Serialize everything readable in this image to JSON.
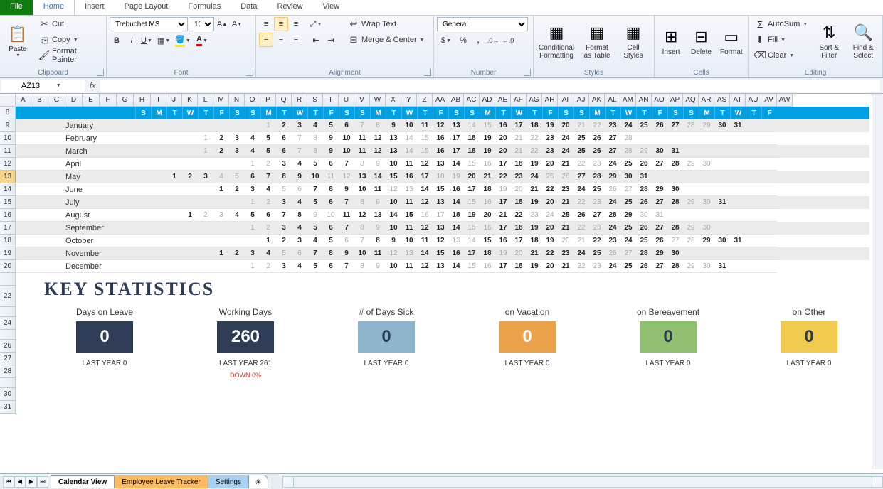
{
  "tabs": {
    "file": "File",
    "home": "Home",
    "insert": "Insert",
    "page_layout": "Page Layout",
    "formulas": "Formulas",
    "data": "Data",
    "review": "Review",
    "view": "View"
  },
  "ribbon": {
    "clipboard": {
      "paste": "Paste",
      "cut": "Cut",
      "copy": "Copy",
      "format_painter": "Format Painter",
      "label": "Clipboard"
    },
    "font": {
      "name": "Trebuchet MS",
      "size": "10",
      "label": "Font"
    },
    "alignment": {
      "wrap": "Wrap Text",
      "merge": "Merge & Center",
      "label": "Alignment"
    },
    "number": {
      "format": "General",
      "label": "Number"
    },
    "styles": {
      "cond": "Conditional\nFormatting",
      "table": "Format\nas Table",
      "cell": "Cell\nStyles",
      "label": "Styles"
    },
    "cells": {
      "insert": "Insert",
      "delete": "Delete",
      "format": "Format",
      "label": "Cells"
    },
    "editing": {
      "autosum": "AutoSum",
      "fill": "Fill",
      "clear": "Clear",
      "sort": "Sort &\nFilter",
      "find": "Find &\nSelect",
      "label": "Editing"
    }
  },
  "namebox": "AZ13",
  "col_widths": {
    "A": 22,
    "month": 168,
    "day": 22
  },
  "columns": [
    "A",
    "B",
    "C",
    "D",
    "E",
    "F",
    "G",
    "H",
    "I",
    "J",
    "K",
    "L",
    "M",
    "N",
    "O",
    "P",
    "Q",
    "R",
    "S",
    "T",
    "U",
    "V",
    "W",
    "X",
    "Y",
    "Z",
    "AA",
    "AB",
    "AC",
    "AD",
    "AE",
    "AF",
    "AG",
    "AH",
    "AI",
    "AJ",
    "AK",
    "AL",
    "AM",
    "AN",
    "AO",
    "AP",
    "AQ",
    "AR",
    "AS",
    "AT",
    "AU",
    "AV",
    "AW"
  ],
  "row_nums": [
    "8",
    "9",
    "10",
    "11",
    "12",
    "13",
    "14",
    "15",
    "16",
    "17",
    "18",
    "19",
    "20",
    "",
    "22",
    "",
    "24",
    "",
    "26",
    "27",
    "28",
    "",
    "30",
    "31"
  ],
  "selected_row_index": 5,
  "dow": [
    "S",
    "M",
    "T",
    "W",
    "T",
    "F",
    "S",
    "S",
    "M",
    "T",
    "W",
    "T",
    "F",
    "S",
    "S",
    "M",
    "T",
    "W",
    "T",
    "F",
    "S",
    "S",
    "M",
    "T",
    "W",
    "T",
    "F",
    "S",
    "S",
    "M",
    "T",
    "W",
    "T",
    "F",
    "S",
    "S",
    "M",
    "T",
    "W",
    "T",
    "F",
    "S",
    "S",
    "M",
    "T",
    "W",
    "T",
    "F",
    "S"
  ],
  "months": [
    {
      "name": "January",
      "offset": 8,
      "days": 31,
      "weekend_mods": [
        0,
        1
      ]
    },
    {
      "name": "February",
      "offset": 4,
      "days": 28,
      "weekend_mods": [
        3,
        4
      ]
    },
    {
      "name": "March",
      "offset": 4,
      "days": 31,
      "weekend_mods": [
        3,
        4
      ]
    },
    {
      "name": "April",
      "offset": 7,
      "days": 30,
      "weekend_mods": [
        0,
        1
      ]
    },
    {
      "name": "May",
      "offset": 2,
      "days": 31,
      "weekend_mods": [
        5,
        6
      ]
    },
    {
      "name": "June",
      "offset": 5,
      "days": 30,
      "weekend_mods": [
        2,
        3
      ]
    },
    {
      "name": "July",
      "offset": 7,
      "days": 31,
      "weekend_mods": [
        0,
        1
      ]
    },
    {
      "name": "August",
      "offset": 3,
      "days": 31,
      "weekend_mods": [
        4,
        5
      ]
    },
    {
      "name": "September",
      "offset": 7,
      "days": 30,
      "weekend_mods": [
        0,
        1
      ]
    },
    {
      "name": "October",
      "offset": 8,
      "days": 31,
      "weekend_mods": [
        6,
        0
      ]
    },
    {
      "name": "November",
      "offset": 5,
      "days": 30,
      "weekend_mods": [
        2,
        3
      ]
    },
    {
      "name": "December",
      "offset": 7,
      "days": 31,
      "weekend_mods": [
        0,
        1
      ]
    }
  ],
  "stats_title": "KEY STATISTICS",
  "stats": [
    {
      "title": "Days on Leave",
      "value": "0",
      "color": "#2e3d55",
      "last": "LAST YEAR  0",
      "diff": ""
    },
    {
      "title": "Working Days",
      "value": "260",
      "color": "#2e3d55",
      "last": "LAST YEAR 261",
      "diff": "DOWN 0%"
    },
    {
      "title": "# of Days Sick",
      "value": "0",
      "color": "#8fb5cc",
      "last": "LAST YEAR 0",
      "diff": ""
    },
    {
      "title": "on Vacation",
      "value": "0",
      "color": "#e9a24a",
      "last": "LAST YEAR 0",
      "diff": ""
    },
    {
      "title": "on Bereavement",
      "value": "0",
      "color": "#8fc070",
      "last": "LAST YEAR 0",
      "diff": ""
    },
    {
      "title": "on Other",
      "value": "0",
      "color": "#f0ca4d",
      "last": "LAST YEAR 0",
      "diff": ""
    }
  ],
  "sheet_tabs": {
    "s1": "Calendar View",
    "s2": "Employee Leave Tracker",
    "s3": "Settings"
  }
}
